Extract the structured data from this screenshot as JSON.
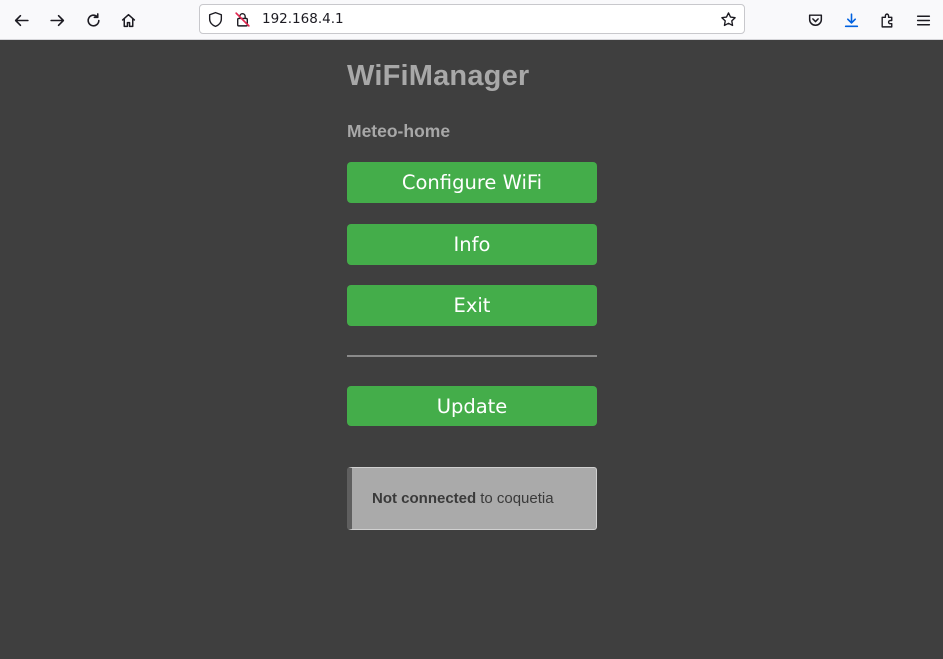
{
  "browser": {
    "url": "192.168.4.1"
  },
  "page": {
    "title": "WiFiManager",
    "subtitle": "Meteo-home",
    "buttons": {
      "configure": "Configure WiFi",
      "info": "Info",
      "exit": "Exit",
      "update": "Update"
    },
    "status": {
      "bold": "Not connected",
      "rest": "to coquetia"
    }
  },
  "colors": {
    "background": "#3f3f3f",
    "button": "#44ad4a",
    "heading": "#a8a8a8"
  }
}
